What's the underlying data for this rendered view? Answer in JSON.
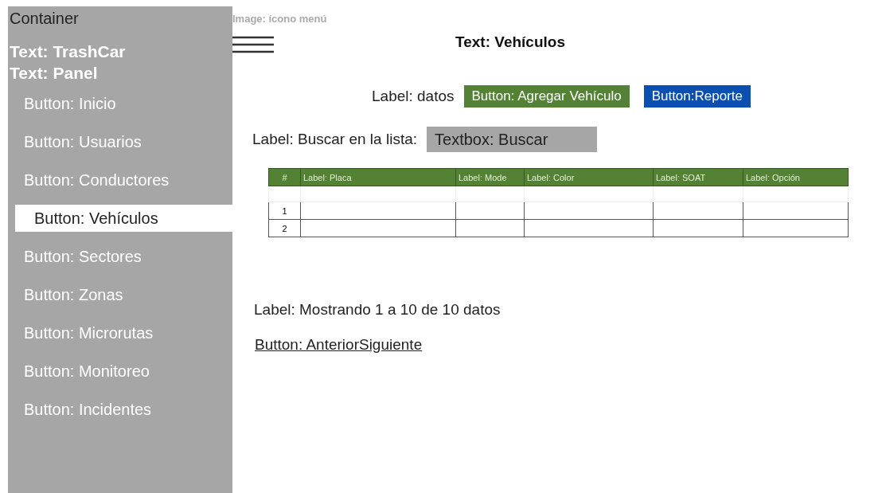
{
  "sidebar": {
    "container_label": "Container",
    "app_title": "Text: TrashCar",
    "subtitle": "Text: Panel",
    "items": [
      {
        "label": "Button: Inicio",
        "selected": false
      },
      {
        "label": "Button: Usuarios",
        "selected": false
      },
      {
        "label": "Button: Conductores",
        "selected": false
      },
      {
        "label": "Button: Vehículos",
        "selected": true
      },
      {
        "label": "Button: Sectores",
        "selected": false
      },
      {
        "label": "Button: Zonas",
        "selected": false
      },
      {
        "label": "Button: Microrutas",
        "selected": false
      },
      {
        "label": "Button: Monitoreo",
        "selected": false
      },
      {
        "label": "Button: Incidentes",
        "selected": false
      }
    ]
  },
  "header": {
    "menu_icon_label": "Image: ícono menú",
    "title": "Text: Vehículos"
  },
  "actions": {
    "label": "Label: datos",
    "add_button": "Button: Agregar Vehículo",
    "report_button": "Button:Reporte"
  },
  "search": {
    "label": "Label: Buscar en la lista:",
    "value": "Textbox: Buscar"
  },
  "table": {
    "columns": [
      "#",
      "Label: Placa",
      "Label: Mode",
      "Label: Color",
      "Label: SOAT",
      "Label: Opción"
    ],
    "rows": [
      [
        ""
      ],
      [
        "1"
      ],
      [
        "2"
      ]
    ]
  },
  "status": "Label: Mostrando 1 a 10 de 10 datos",
  "pager": "Button: AnteriorSiguiente"
}
